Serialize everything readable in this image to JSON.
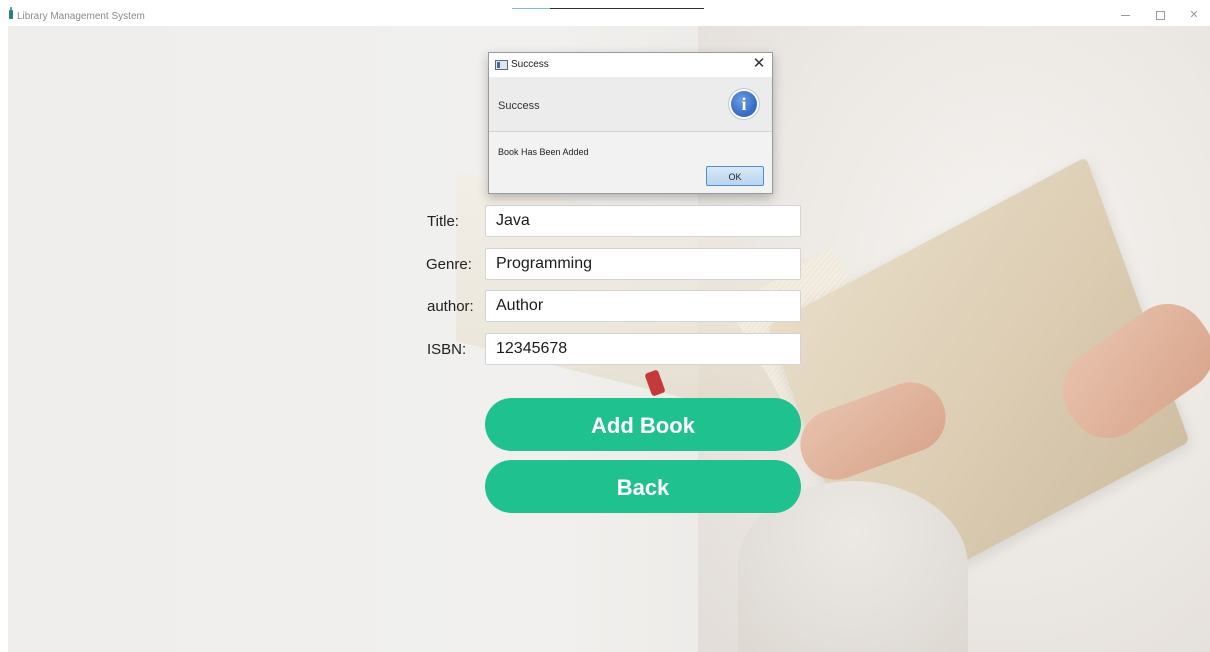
{
  "window": {
    "title": "Library Management System",
    "controls": {
      "minimize": "minimize-icon",
      "maximize": "maximize-icon",
      "close": "close-icon"
    }
  },
  "form": {
    "title": {
      "label": "Title:",
      "value": "Java"
    },
    "genre": {
      "label": "Genre:",
      "value": "Programming"
    },
    "author": {
      "label": "author:",
      "value": "Author"
    },
    "isbn": {
      "label": "ISBN:",
      "value": "12345678"
    }
  },
  "buttons": {
    "add_book": "Add Book",
    "back": "Back"
  },
  "dialog": {
    "title": "Success",
    "header": "Success",
    "content": "Book Has Been Added",
    "ok_label": "OK",
    "icon": "info-icon"
  },
  "colors": {
    "accent": "#1fc18e",
    "dialog_icon": "#3a6fc9",
    "dialog_ok_border": "#4f8fc9"
  }
}
